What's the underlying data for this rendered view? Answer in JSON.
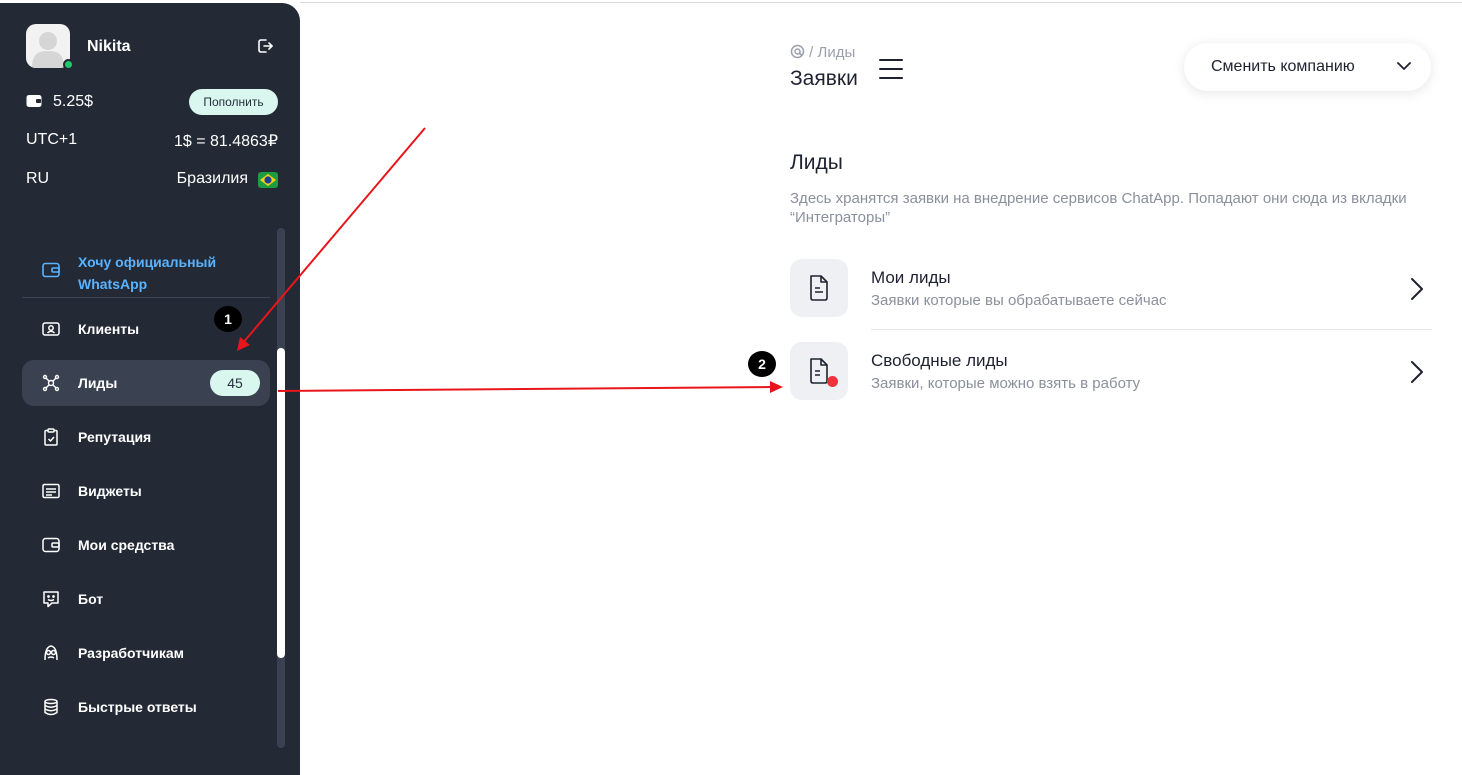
{
  "sidebar": {
    "user_name": "Nikita",
    "balance": "5.25$",
    "topup_label": "Пополнить",
    "timezone": "UTC+1",
    "rate": "1$ = 81.4863₽",
    "language": "RU",
    "country": "Бразилия",
    "whatsapp_label": "Хочу официальный WhatsApp",
    "items": [
      {
        "label": "Клиенты",
        "icon": "contact-card-icon"
      },
      {
        "label": "Лиды",
        "icon": "network-icon",
        "badge": "45",
        "active": true
      },
      {
        "label": "Репутация",
        "icon": "clipboard-check-icon"
      },
      {
        "label": "Виджеты",
        "icon": "widget-icon"
      },
      {
        "label": "Мои средства",
        "icon": "wallet-icon"
      },
      {
        "label": "Бот",
        "icon": "bot-chat-icon"
      },
      {
        "label": "Разработчикам",
        "icon": "developer-icon"
      },
      {
        "label": "Быстрые ответы",
        "icon": "database-icon"
      }
    ]
  },
  "header": {
    "breadcrumb_current": "Лиды",
    "title": "Заявки",
    "company_button": "Сменить компанию"
  },
  "main": {
    "section_title": "Лиды",
    "description": "Здесь хранятся заявки на внедрение сервисов ChatApp. Попадают они сюда из вкладки “Интеграторы”",
    "rows": [
      {
        "title": "Мои лиды",
        "subtitle": "Заявки которые вы обрабатываете сейчас"
      },
      {
        "title": "Свободные лиды",
        "subtitle": "Заявки, которые можно взять в работу"
      }
    ]
  },
  "annotations": {
    "step1": "1",
    "step2": "2",
    "arrow_color": "#e8161a"
  },
  "colors": {
    "sidebar_bg": "#232935",
    "accent_blue": "#5ab3ff",
    "badge_bg": "#d9f7ef",
    "notification_red": "#f0323c"
  }
}
